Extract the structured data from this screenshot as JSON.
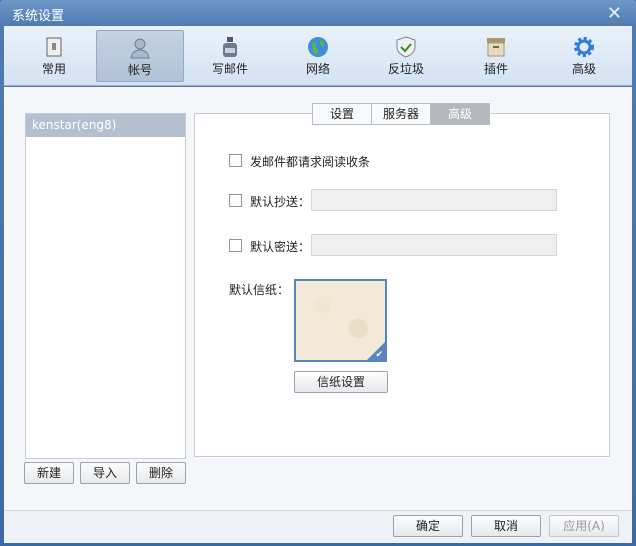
{
  "window": {
    "title": "系统设置",
    "close": "✕"
  },
  "toolbar": [
    {
      "label": "常用",
      "icon": "switch-icon"
    },
    {
      "label": "帐号",
      "icon": "user-icon"
    },
    {
      "label": "写邮件",
      "icon": "ink-bottle-icon"
    },
    {
      "label": "网络",
      "icon": "globe-icon"
    },
    {
      "label": "反垃圾",
      "icon": "shield-icon"
    },
    {
      "label": "插件",
      "icon": "box-icon"
    },
    {
      "label": "高级",
      "icon": "gear-icon"
    }
  ],
  "accounts": {
    "items": [
      "kenstar(eng8)"
    ],
    "new": "新建",
    "import": "导入",
    "delete": "删除"
  },
  "tabs": [
    "设置",
    "服务器",
    "高级"
  ],
  "advanced": {
    "read_receipt": "发邮件都请求阅读收条",
    "cc_label": "默认抄送：",
    "cc_value": "",
    "bcc_label": "默认密送：",
    "bcc_value": "",
    "stationery_label": "默认信纸：",
    "stationery_button": "信纸设置"
  },
  "footer": {
    "ok": "确定",
    "cancel": "取消",
    "apply": "应用(A)"
  }
}
